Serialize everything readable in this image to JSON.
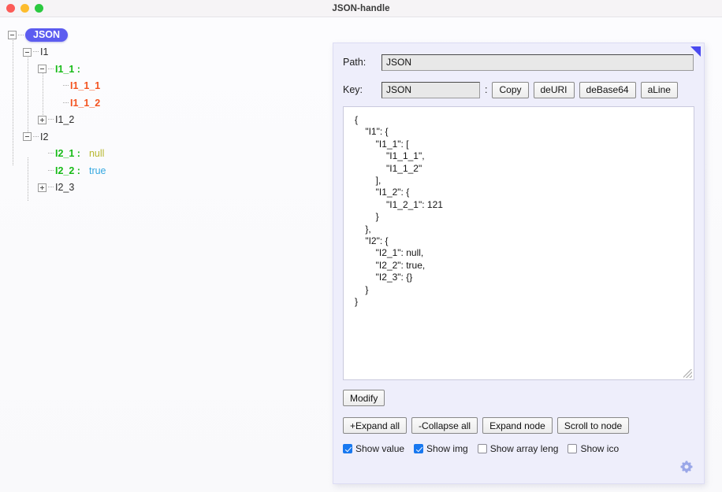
{
  "window": {
    "title": "JSON-handle",
    "traffic_lights": [
      "close-button",
      "minimize-button",
      "maximize-button"
    ]
  },
  "tree": {
    "root_label": "JSON",
    "nodes": [
      {
        "label": "JSON",
        "type": "root-badge",
        "depth": 0,
        "toggle": "minus"
      },
      {
        "label": "I1",
        "type": "plain",
        "depth": 1,
        "toggle": "minus"
      },
      {
        "label": "I1_1 :",
        "type": "key-green",
        "depth": 2,
        "toggle": "minus"
      },
      {
        "label": "I1_1_1",
        "type": "item-orange",
        "depth": 3,
        "toggle": "none"
      },
      {
        "label": "I1_1_2",
        "type": "item-orange",
        "depth": 3,
        "toggle": "none"
      },
      {
        "label": "I1_2",
        "type": "plain",
        "depth": 2,
        "toggle": "plus"
      },
      {
        "label": "I2",
        "type": "plain",
        "depth": 1,
        "toggle": "minus"
      },
      {
        "label": "I2_1 :",
        "type": "key-green",
        "depth": 2,
        "toggle": "none",
        "value": "null",
        "value_type": "null"
      },
      {
        "label": "I2_2 :",
        "type": "key-green",
        "depth": 2,
        "toggle": "none",
        "value": "true",
        "value_type": "boolean"
      },
      {
        "label": "I2_3",
        "type": "plain",
        "depth": 2,
        "toggle": "plus"
      }
    ]
  },
  "panel": {
    "path": {
      "label": "Path:",
      "value": "JSON",
      "placeholder": ""
    },
    "key": {
      "label": "Key:",
      "value": "JSON",
      "placeholder": "",
      "separator": ":"
    },
    "key_buttons": [
      {
        "label": "Copy",
        "name": "copy-button"
      },
      {
        "label": "deURI",
        "name": "deuri-button"
      },
      {
        "label": "deBase64",
        "name": "debase64-button"
      },
      {
        "label": "aLine",
        "name": "aline-button"
      }
    ],
    "json_text": "{\n    \"I1\": {\n        \"I1_1\": [\n            \"I1_1_1\",\n            \"I1_1_2\"\n        ],\n        \"I1_2\": {\n            \"I1_2_1\": 121\n        }\n    },\n    \"I2\": {\n        \"I2_1\": null,\n        \"I2_2\": true,\n        \"I2_3\": {}\n    }\n}",
    "modify_button": "Modify",
    "action_buttons": [
      {
        "label": "+Expand all",
        "name": "expand-all-button"
      },
      {
        "label": "-Collapse all",
        "name": "collapse-all-button"
      },
      {
        "label": "Expand node",
        "name": "expand-node-button"
      },
      {
        "label": "Scroll to node",
        "name": "scroll-to-node-button"
      }
    ],
    "checkboxes": [
      {
        "label": "Show value",
        "checked": true,
        "name": "show-value-checkbox"
      },
      {
        "label": "Show img",
        "checked": true,
        "name": "show-img-checkbox"
      },
      {
        "label": "Show array leng",
        "checked": false,
        "name": "show-array-length-checkbox"
      },
      {
        "label": "Show ico",
        "checked": false,
        "name": "show-ico-checkbox"
      }
    ],
    "gear": "settings-gear-icon",
    "corner_marker": "collapse-corner-triangle"
  },
  "colors": {
    "accent_blue": "#5c5cf0",
    "key_green": "#17bb17",
    "item_orange": "#f4531f",
    "null_olive": "#b8b830",
    "true_cyan": "#35a8e0",
    "panel_bg": "#eeeefb",
    "checkbox_blue": "#1878f0"
  }
}
